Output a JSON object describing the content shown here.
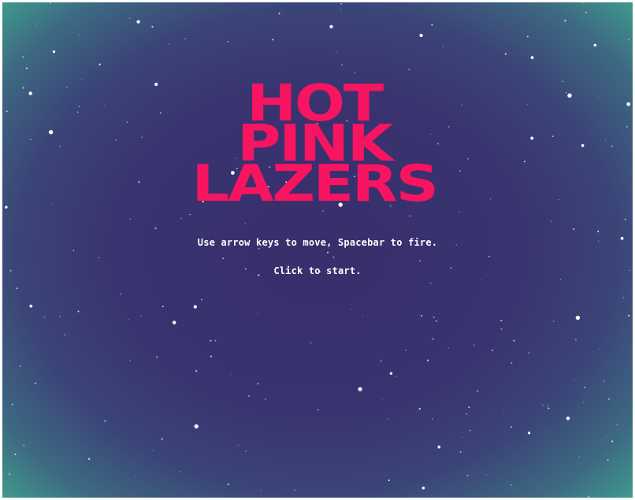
{
  "game": {
    "title": "Hot\nPink\nLazers",
    "instructions": "Use arrow keys to move, Spacebar to fire.",
    "start_prompt": "Click to start."
  },
  "colors": {
    "title": "#f71461",
    "text": "#ffffff",
    "space_center": "#372f6c",
    "space_edge": "#3f9b8c",
    "star": "#ffffff"
  }
}
